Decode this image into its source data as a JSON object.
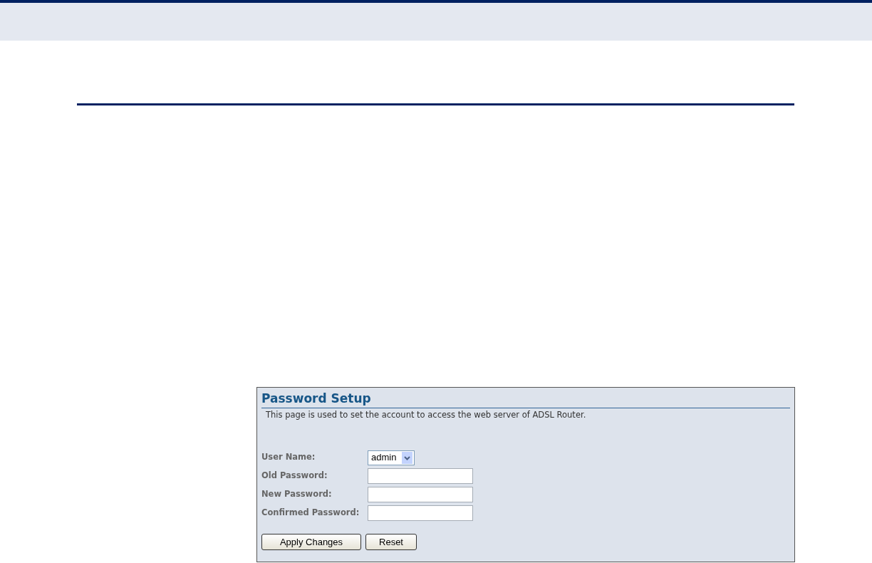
{
  "panel": {
    "title": "Password Setup",
    "description": "This page is used to set the account to access the web server of ADSL Router.",
    "fields": [
      {
        "label": "User Name:",
        "kind": "select",
        "value": "admin"
      },
      {
        "label": "Old Password:",
        "kind": "password"
      },
      {
        "label": "New Password:",
        "kind": "password"
      },
      {
        "label": "Confirmed Password:",
        "kind": "password"
      }
    ],
    "buttons": [
      "Apply Changes",
      "Reset"
    ]
  }
}
